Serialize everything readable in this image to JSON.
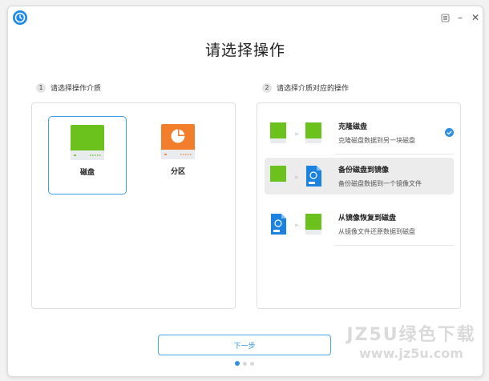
{
  "titlebar": {
    "logo_icon": "deepin-clone-logo-icon",
    "menu_icon": "menu-icon",
    "minimize_glyph": "–",
    "close_glyph": "✕"
  },
  "page_title": "请选择操作",
  "left_section": {
    "step": "1",
    "label": "请选择操作介质",
    "media": [
      {
        "label": "磁盘",
        "icon": "disk-icon",
        "selected": true
      },
      {
        "label": "分区",
        "icon": "partition-icon",
        "selected": false
      }
    ]
  },
  "right_section": {
    "step": "2",
    "label": "请选择介质对应的操作",
    "operations": [
      {
        "title": "克隆磁盘",
        "desc": "克隆磁盘数据到另一块磁盘",
        "selected": true,
        "highlighted": false
      },
      {
        "title": "备份磁盘到镜像",
        "desc": "备份磁盘数据到一个镜像文件",
        "selected": false,
        "highlighted": true
      },
      {
        "title": "从镜像恢复到磁盘",
        "desc": "从镜像文件还原数据到磁盘",
        "selected": false,
        "highlighted": false
      }
    ]
  },
  "next_button": "下一步",
  "pager": {
    "pages": 3,
    "current": 1
  },
  "watermark": {
    "main": "JZ5U绿色下载",
    "url": "www.jz5u.com"
  },
  "colors": {
    "accent": "#2f8fe0",
    "disk_green": "#6cc21c",
    "partition_orange": "#f27d2a",
    "image_blue": "#1b82e0"
  }
}
